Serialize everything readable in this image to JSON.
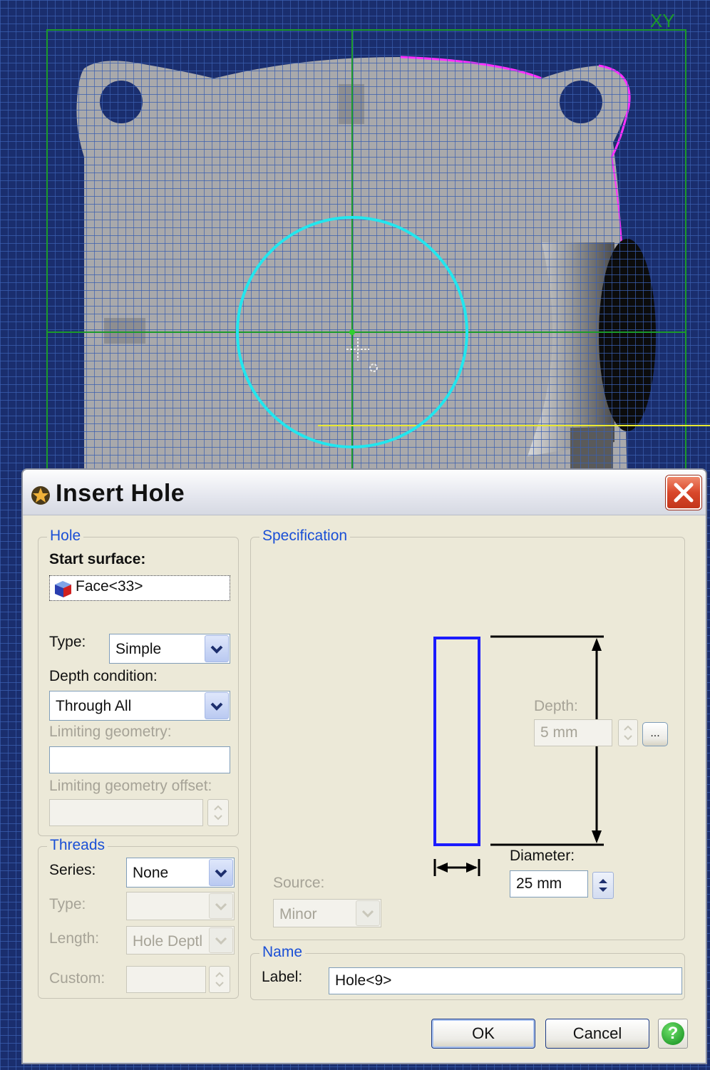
{
  "viewport": {
    "axis_label": "XY"
  },
  "dialog": {
    "title": "Insert Hole",
    "hole_group": {
      "legend": "Hole",
      "start_surface_label": "Start surface:",
      "start_surface_value": "Face<33>",
      "type_label": "Type:",
      "type_value": "Simple",
      "depth_condition_label": "Depth condition:",
      "depth_condition_value": "Through All",
      "limiting_geometry_label": "Limiting geometry:",
      "limiting_geometry_value": "",
      "limiting_offset_label": "Limiting geometry offset:",
      "limiting_offset_value": ""
    },
    "threads_group": {
      "legend": "Threads",
      "series_label": "Series:",
      "series_value": "None",
      "type_label": "Type:",
      "type_value": "",
      "length_label": "Length:",
      "length_value": "Hole Deptl",
      "custom_label": "Custom:",
      "custom_value": ""
    },
    "specification_group": {
      "legend": "Specification",
      "depth_label": "Depth:",
      "depth_value": "5 mm",
      "depth_more_button": "...",
      "diameter_label": "Diameter:",
      "diameter_value": "25 mm",
      "source_label": "Source:",
      "source_value": "Minor"
    },
    "name_group": {
      "legend": "Name",
      "label_label": "Label:",
      "label_value": "Hole<9>"
    },
    "buttons": {
      "ok": "OK",
      "cancel": "Cancel",
      "help": "?"
    }
  }
}
